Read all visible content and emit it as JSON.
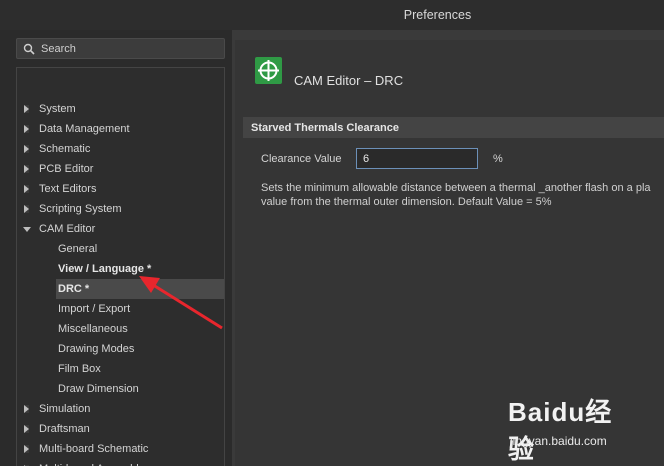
{
  "window": {
    "title": "Preferences"
  },
  "search": {
    "label": "Search"
  },
  "tree": [
    {
      "label": "System",
      "level": 0,
      "expanded": false
    },
    {
      "label": "Data Management",
      "level": 0,
      "expanded": false
    },
    {
      "label": "Schematic",
      "level": 0,
      "expanded": false
    },
    {
      "label": "PCB Editor",
      "level": 0,
      "expanded": false
    },
    {
      "label": "Text Editors",
      "level": 0,
      "expanded": false
    },
    {
      "label": "Scripting System",
      "level": 0,
      "expanded": false
    },
    {
      "label": "CAM Editor",
      "level": 0,
      "expanded": true
    },
    {
      "label": "General",
      "level": 1
    },
    {
      "label": "View / Language *",
      "level": 1,
      "bold": true
    },
    {
      "label": "DRC *",
      "level": 1,
      "bold": true,
      "selected": true
    },
    {
      "label": "Import / Export",
      "level": 1
    },
    {
      "label": "Miscellaneous",
      "level": 1
    },
    {
      "label": "Drawing Modes",
      "level": 1
    },
    {
      "label": "Film Box",
      "level": 1
    },
    {
      "label": "Draw Dimension",
      "level": 1
    },
    {
      "label": "Simulation",
      "level": 0,
      "expanded": false
    },
    {
      "label": "Draftsman",
      "level": 0,
      "expanded": false
    },
    {
      "label": "Multi-board Schematic",
      "level": 0,
      "expanded": false
    },
    {
      "label": "Multi-board Assembly",
      "level": 0,
      "expanded": false
    }
  ],
  "page": {
    "title": "CAM Editor – DRC",
    "icon": "crosshair-target-icon",
    "icon_color": "#2f9a45"
  },
  "section": {
    "title": "Starved Thermals Clearance",
    "field_label": "Clearance Value",
    "field_value": "6",
    "unit": "%",
    "description_line1": "Sets the minimum allowable distance between a thermal _another flash on a pla",
    "description_line2": "value from the thermal outer dimension. Default Value = 5%"
  },
  "annotation": {
    "color": "#e8262d"
  },
  "watermark": {
    "brand": "Baidu经验",
    "url": "jingyan.baidu.com"
  }
}
